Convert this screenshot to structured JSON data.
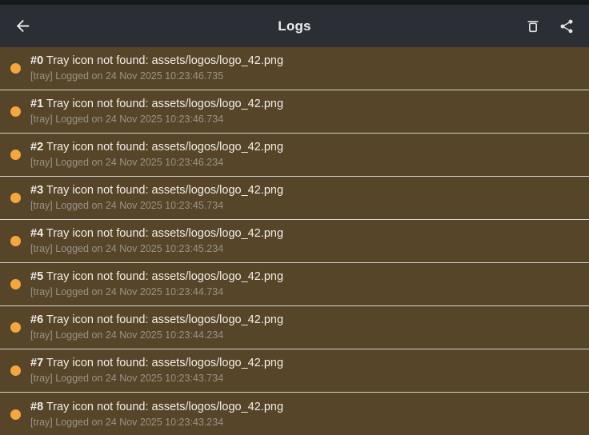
{
  "colors": {
    "status_bar": "#17181c",
    "app_bar": "#2b2e35",
    "header_text": "#e8eaed",
    "row_background": "#564528",
    "separator": "#d8d3cc",
    "dot": "#f4a63f",
    "title_text": "#f2eee8",
    "meta_text": "#9a9289"
  },
  "header": {
    "title": "Logs",
    "back_icon": "arrow-left-icon",
    "actions": [
      {
        "name": "delete-logs",
        "icon": "trash-icon"
      },
      {
        "name": "share-logs",
        "icon": "share-icon"
      }
    ]
  },
  "log_rows": [
    {
      "index": "#0",
      "message": "Tray icon not found: assets/logos/logo_42.png",
      "meta": "[tray] Logged on 24 Nov 2025 10:23:46.735",
      "dot_color": "#f4a63f"
    },
    {
      "index": "#1",
      "message": "Tray icon not found: assets/logos/logo_42.png",
      "meta": "[tray] Logged on 24 Nov 2025 10:23:46.734",
      "dot_color": "#f4a63f"
    },
    {
      "index": "#2",
      "message": "Tray icon not found: assets/logos/logo_42.png",
      "meta": "[tray] Logged on 24 Nov 2025 10:23:46.234",
      "dot_color": "#f4a63f"
    },
    {
      "index": "#3",
      "message": "Tray icon not found: assets/logos/logo_42.png",
      "meta": "[tray] Logged on 24 Nov 2025 10:23:45.734",
      "dot_color": "#f4a63f"
    },
    {
      "index": "#4",
      "message": "Tray icon not found: assets/logos/logo_42.png",
      "meta": "[tray] Logged on 24 Nov 2025 10:23:45.234",
      "dot_color": "#f4a63f"
    },
    {
      "index": "#5",
      "message": "Tray icon not found: assets/logos/logo_42.png",
      "meta": "[tray] Logged on 24 Nov 2025 10:23:44.734",
      "dot_color": "#f4a63f"
    },
    {
      "index": "#6",
      "message": "Tray icon not found: assets/logos/logo_42.png",
      "meta": "[tray] Logged on 24 Nov 2025 10:23:44.234",
      "dot_color": "#f4a63f"
    },
    {
      "index": "#7",
      "message": "Tray icon not found: assets/logos/logo_42.png",
      "meta": "[tray] Logged on 24 Nov 2025 10:23:43.734",
      "dot_color": "#f4a63f"
    },
    {
      "index": "#8",
      "message": "Tray icon not found: assets/logos/logo_42.png",
      "meta": "[tray] Logged on 24 Nov 2025 10:23:43.234",
      "dot_color": "#f4a63f"
    }
  ]
}
